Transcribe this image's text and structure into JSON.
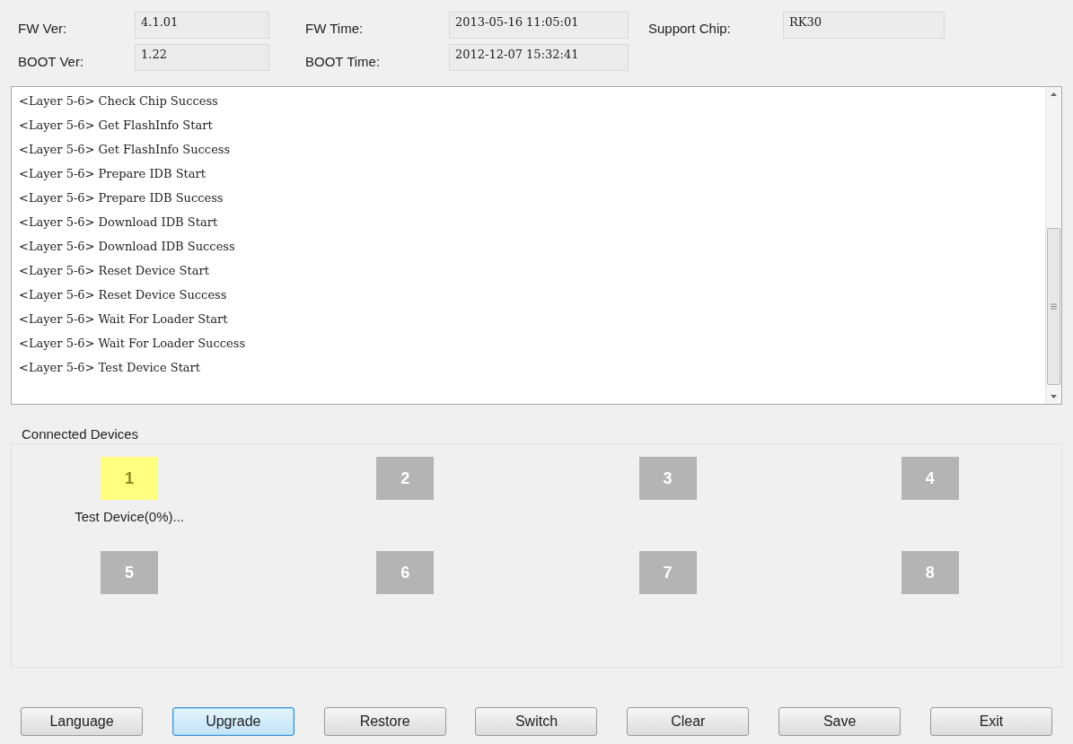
{
  "info": [
    {
      "label": "FW Ver:",
      "value": "4.1.01"
    },
    {
      "label": "FW Time:",
      "value": "2013-05-16 11:05:01"
    },
    {
      "label": "Support Chip:",
      "value": "RK30"
    },
    {
      "label": "BOOT Ver:",
      "value": "1.22"
    },
    {
      "label": "BOOT Time:",
      "value": "2012-12-07 15:32:41"
    }
  ],
  "log": [
    "<Layer 5-6> Check Chip Success",
    "<Layer 5-6> Get FlashInfo Start",
    "<Layer 5-6> Get FlashInfo Success",
    "<Layer 5-6> Prepare IDB Start",
    "<Layer 5-6> Prepare IDB Success",
    "<Layer 5-6> Download IDB Start",
    "<Layer 5-6> Download IDB Success",
    "<Layer 5-6> Reset Device Start",
    "<Layer 5-6> Reset Device Success",
    "<Layer 5-6> Wait For Loader Start",
    "<Layer 5-6> Wait For Loader Success",
    "<Layer 5-6> Test Device Start"
  ],
  "devices": {
    "title": "Connected Devices",
    "items": [
      {
        "number": "1",
        "active": true,
        "status": "Test Device(0%)..."
      },
      {
        "number": "2",
        "active": false
      },
      {
        "number": "3",
        "active": false
      },
      {
        "number": "4",
        "active": false
      },
      {
        "number": "5",
        "active": false
      },
      {
        "number": "6",
        "active": false
      },
      {
        "number": "7",
        "active": false
      },
      {
        "number": "8",
        "active": false
      }
    ]
  },
  "buttons": [
    {
      "label": "Language",
      "focused": false
    },
    {
      "label": "Upgrade",
      "focused": true
    },
    {
      "label": "Restore",
      "focused": false
    },
    {
      "label": "Switch",
      "focused": false
    },
    {
      "label": "Clear",
      "focused": false
    },
    {
      "label": "Save",
      "focused": false
    },
    {
      "label": "Exit",
      "focused": false
    }
  ]
}
